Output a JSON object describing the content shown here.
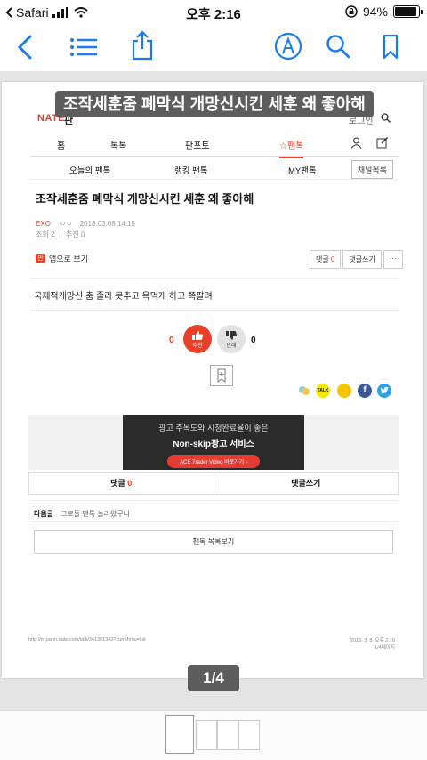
{
  "status_bar": {
    "carrier": "Safari",
    "time": "오후 2:16",
    "battery": "94%",
    "battery_level": 0.94
  },
  "toolbar": {
    "icons": [
      "back-icon",
      "list-icon",
      "share-icon",
      "markup-icon",
      "search-icon",
      "bookmark-icon"
    ]
  },
  "document": {
    "title_overlay": "조작세훈줌 폐막식 개망신시킨 세훈 왜 좋아해",
    "page_indicator": "1/4"
  },
  "page": {
    "logo": "NATE",
    "section": "판",
    "login": "로그인",
    "nav": [
      "홈",
      "톡톡",
      "판포토",
      "☆팬톡"
    ],
    "subnav": [
      "오늘의 팬톡",
      "랭킹 팬톡",
      "MY팬톡"
    ],
    "channel_list": "채널목록",
    "article_title": "조작세훈줌 폐막식 개망신시킨 세훈 왜 좋아해",
    "author": "EXO",
    "author_extra": "ㅇㅇ",
    "datetime": "2018.03.08 14:15",
    "views": "조회 2",
    "recommend_meta": "추천 0",
    "app_view": "앱으로 보기",
    "comment_btn_label": "댓글",
    "comment_count": "0",
    "write_comment": "댓글쓰기",
    "more": "···",
    "body": "국제적개망신 춤 졸라 못추고 욕먹게 하고 쪽팔려",
    "like_count": "0",
    "like_label": "추천",
    "dislike_count": "0",
    "dislike_label": "반대",
    "ad_line1": "광고 주목도와 시청완료율이 좋은",
    "ad_line2": "Non-skip광고 서비스",
    "ad_button": "ACE Trader Video 바로가기 ›",
    "tab_comments": "댓글",
    "tab_comments_count": "0",
    "tab_write": "댓글쓰기",
    "next_label": "다음글",
    "next_title": "그로들 팬톡 놀러왔구나",
    "list_button": "팬톡 목록보기",
    "footer_url": "http://m.pann.nate.com/talk/341301343?currMenu=list",
    "footer_date": "2018. 3. 8. 오후 2:16",
    "footer_pages": "1/4페이지"
  },
  "thumbnails": {
    "count": 4,
    "selected": 1
  }
}
